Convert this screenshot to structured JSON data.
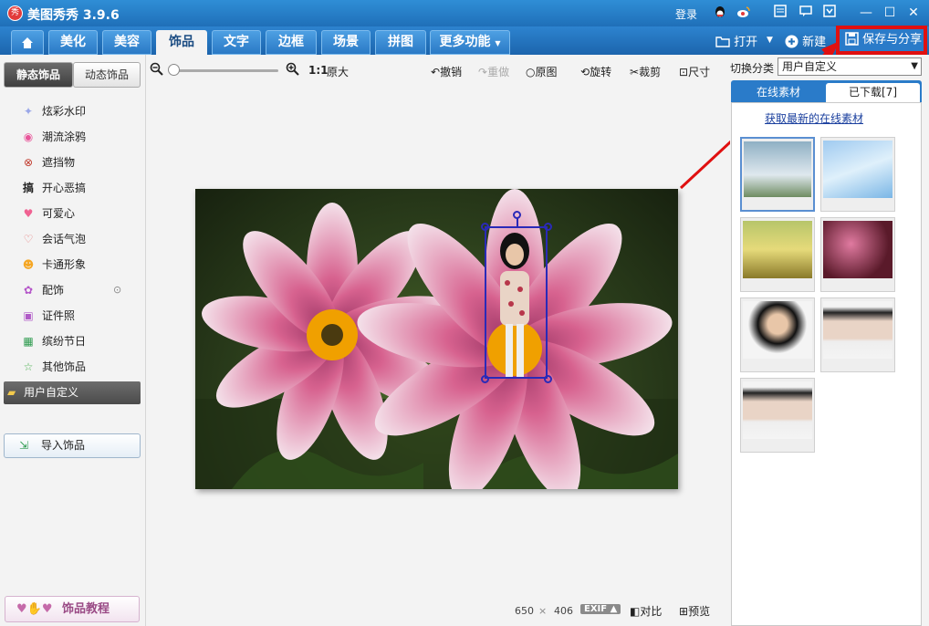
{
  "app": {
    "title": "美图秀秀 3.9.6",
    "logo_text": "秀"
  },
  "titlebar": {
    "login": "登录"
  },
  "nav": {
    "tabs": [
      "美化",
      "美容",
      "饰品",
      "文字",
      "边框",
      "场景",
      "拼图"
    ],
    "more": "更多功能",
    "open": "打开",
    "new": "新建",
    "save_share": "保存与分享"
  },
  "left": {
    "tab_static": "静态饰品",
    "tab_dynamic": "动态饰品",
    "categories": [
      "炫彩水印",
      "潮流涂鸦",
      "遮挡物",
      "开心恶搞",
      "可爱心",
      "会话气泡",
      "卡通形象",
      "配饰",
      "证件照",
      "缤纷节日",
      "其他饰品"
    ],
    "custom": "用户自定义",
    "import": "导入饰品",
    "tutorial": "饰品教程"
  },
  "toolbar": {
    "zoom_ratio": "1:1",
    "original_size": "原大",
    "undo": "撤销",
    "redo": "重做",
    "original": "原图",
    "rotate": "旋转",
    "crop": "裁剪",
    "size": "尺寸"
  },
  "status": {
    "width": "650",
    "x": "×",
    "height": "406",
    "exif": "EXIF",
    "compare": "对比",
    "preview": "预览"
  },
  "right": {
    "switch_label": "切换分类",
    "switch_value": "用户自定义",
    "tab_online": "在线素材",
    "tab_downloaded": "已下载[7]",
    "get_latest": "获取最新的在线素材"
  },
  "colors": {
    "accent": "#2a7bc9",
    "highlight": "#e01010"
  }
}
